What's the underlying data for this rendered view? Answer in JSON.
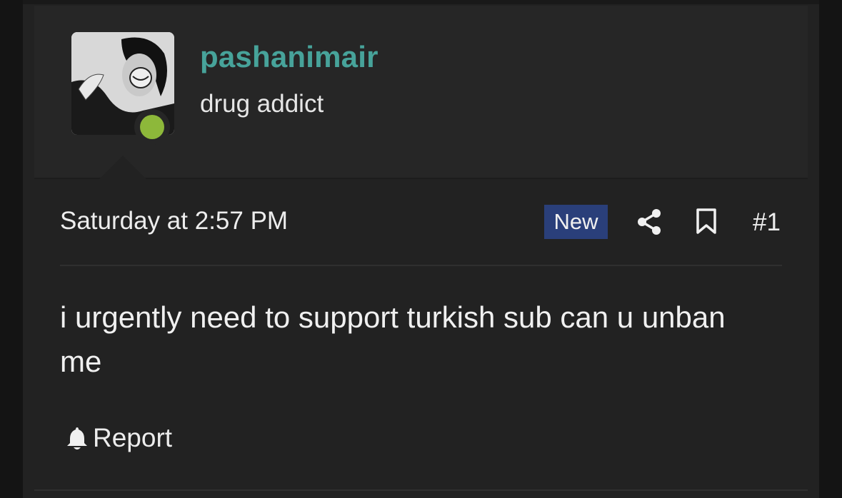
{
  "user": {
    "username": "pashanimair",
    "title": "drug addict",
    "online": true
  },
  "post": {
    "date": "Saturday at 2:57 PM",
    "badge": "New",
    "number": "#1",
    "body": "i urgently need to support turkish sub can u unban me",
    "report_label": "Report"
  },
  "colors": {
    "username": "#47a39a",
    "badge_bg": "#2a3f7a",
    "online": "#8db83a"
  },
  "icons": [
    "share-icon",
    "bookmark-icon",
    "bell-icon"
  ]
}
